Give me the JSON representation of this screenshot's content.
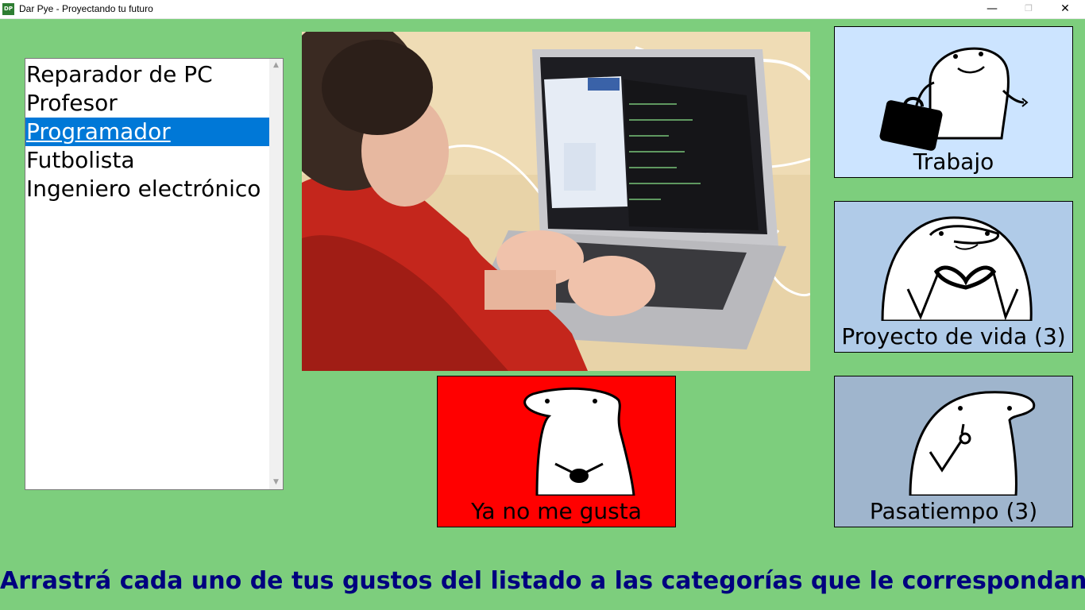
{
  "window": {
    "title": "Dar Pye - Proyectando tu futuro",
    "icon_text": "DP",
    "minimize": "—",
    "maximize": "❐",
    "close": "✕"
  },
  "list": {
    "items": [
      "Reparador de PC",
      "Profesor",
      "Programador",
      "Futbolista",
      "Ingeniero electrónico"
    ],
    "selected": "Programador",
    "scroll_up": "▲",
    "scroll_down": "▼"
  },
  "categories": {
    "trabajo": "Trabajo",
    "proyecto": "Proyecto de vida (3)",
    "pasatiempo": "Pasatiempo (3)",
    "no_gusta": "Ya no me gusta"
  },
  "instruction": "Arrastrá cada uno de tus gustos del listado a las categorías que le correspondan",
  "colors": {
    "background": "#7dce7d",
    "selection": "#0078d7",
    "instruction_text": "#00007f",
    "trabajo_card": "#cce4ff",
    "proyecto_card": "#b0cbe8",
    "pasatiempo_card": "#9fb5cd",
    "no_gusta_card": "#ff0000"
  }
}
